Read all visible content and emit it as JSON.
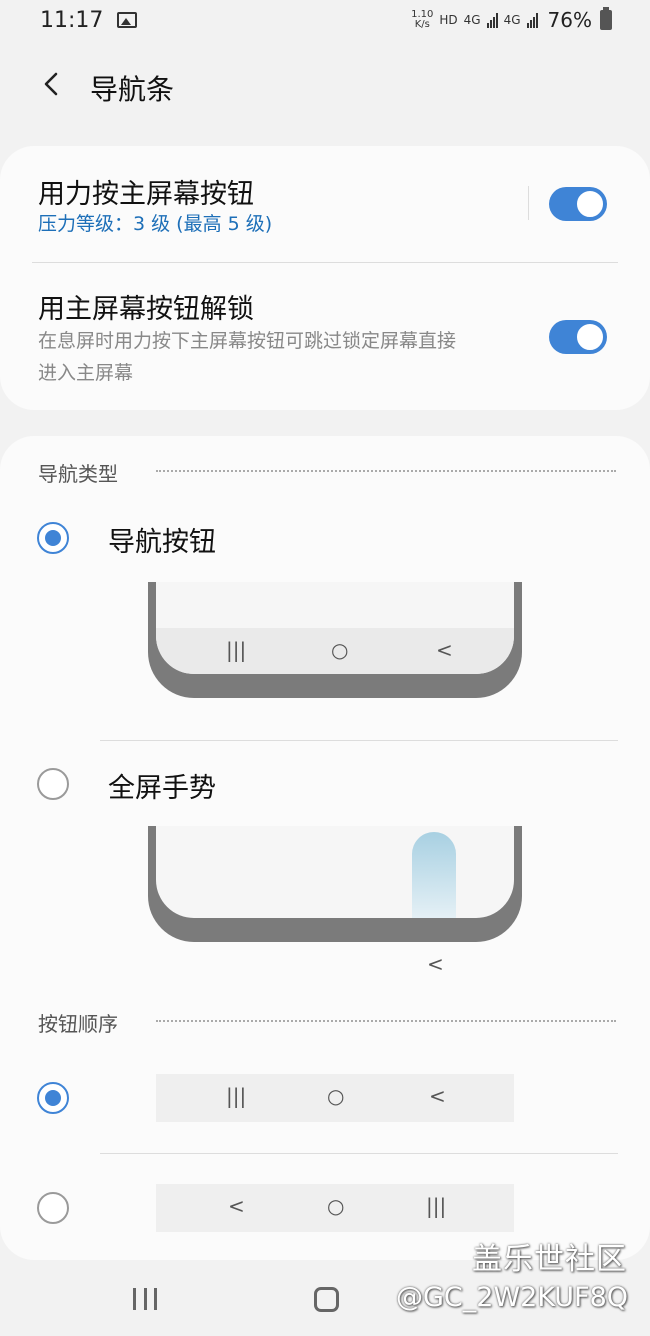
{
  "status_bar": {
    "time": "11:17",
    "speed_value": "1.10",
    "speed_unit": "K/s",
    "hd": "HD",
    "net1": "4G",
    "net2": "4G",
    "battery_pct": "76%",
    "icons": [
      "image-notification-icon",
      "signal-icon",
      "battery-icon"
    ]
  },
  "header": {
    "back_icon": "chevron-left-icon",
    "title": "导航条"
  },
  "settings": {
    "force_press": {
      "title": "用力按主屏幕按钮",
      "subtitle": "压力等级：3 级 (最高 5 级)",
      "enabled": true
    },
    "unlock": {
      "title": "用主屏幕按钮解锁",
      "subtitle_line1": "在息屏时用力按下主屏幕按钮可跳过锁定屏幕直接",
      "subtitle_line2": "进入主屏幕",
      "enabled": true
    }
  },
  "nav_type": {
    "label": "导航类型",
    "options": [
      {
        "label": "导航按钮",
        "selected": true,
        "preview_glyphs": [
          "|||",
          "○",
          "<"
        ]
      },
      {
        "label": "全屏手势",
        "selected": false,
        "preview_glyphs": [
          "<"
        ]
      }
    ]
  },
  "button_order": {
    "label": "按钮顺序",
    "options": [
      {
        "selected": true,
        "glyphs": [
          "|||",
          "○",
          "<"
        ]
      },
      {
        "selected": false,
        "glyphs": [
          "<",
          "○",
          "|||"
        ]
      }
    ]
  },
  "watermark": {
    "line1": "盖乐世社区",
    "line2": "@GC_2W2KUF8Q"
  },
  "system_nav": {
    "icons": [
      "recent-apps-icon",
      "home-icon"
    ]
  },
  "colors": {
    "accent": "#3f84d6",
    "subtitle_accent": "#1d6fb8",
    "background": "#f2f2f2",
    "card": "#fbfbfb"
  }
}
